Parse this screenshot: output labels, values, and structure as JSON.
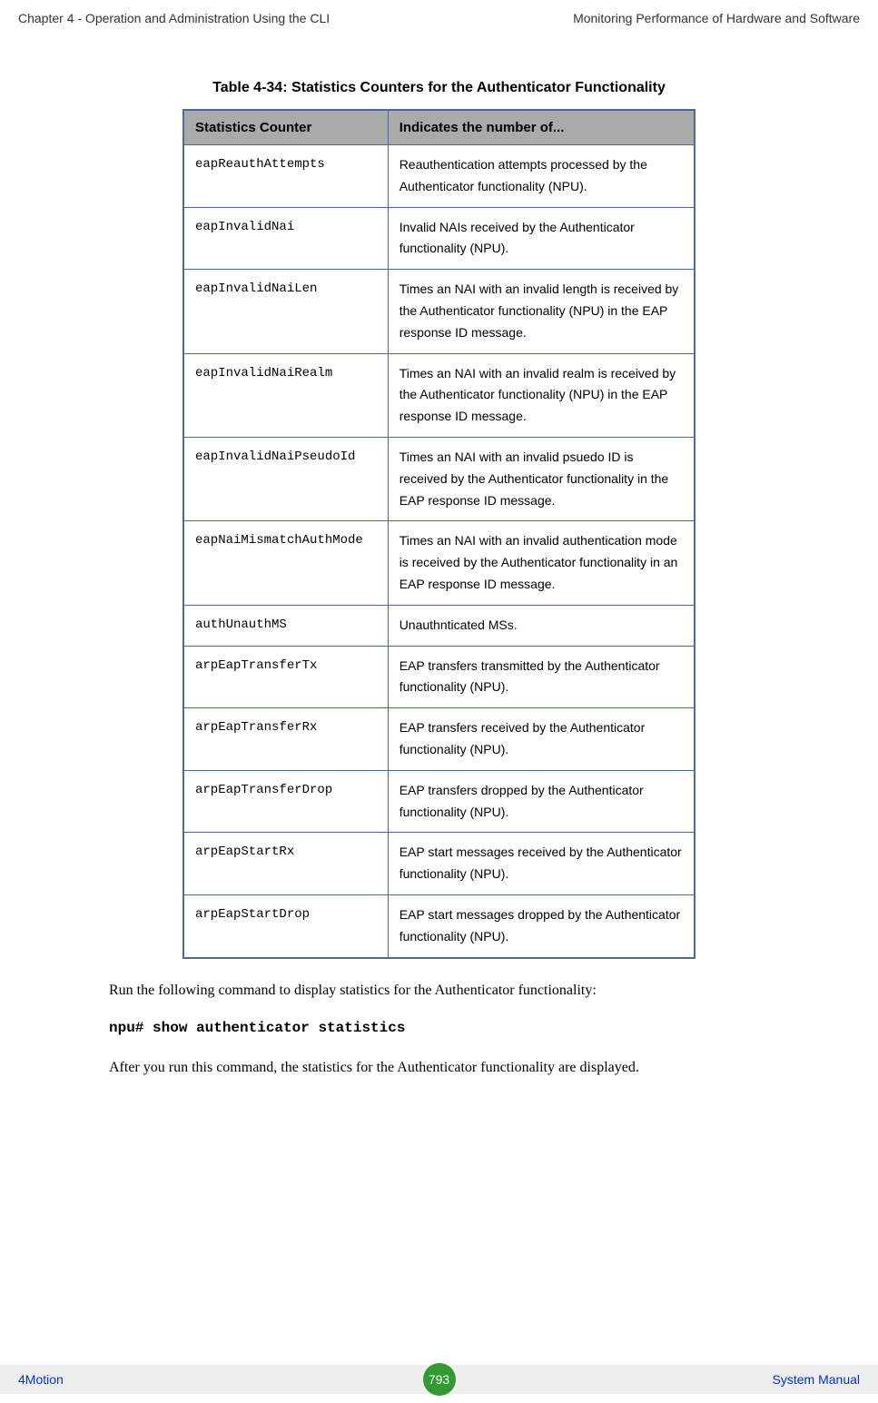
{
  "header": {
    "left": "Chapter 4 - Operation and Administration Using the CLI",
    "right": "Monitoring Performance of Hardware and Software"
  },
  "table": {
    "caption": "Table 4-34: Statistics Counters for the Authenticator Functionality",
    "headers": {
      "col1": "Statistics Counter",
      "col2": "Indicates the number of..."
    },
    "rows": [
      {
        "counter": "eapReauthAttempts",
        "desc": "Reauthentication attempts processed by the Authenticator functionality (NPU)."
      },
      {
        "counter": "eapInvalidNai",
        "desc": "Invalid NAIs received by the Authenticator functionality (NPU)."
      },
      {
        "counter": "eapInvalidNaiLen",
        "desc": "Times an NAI with an invalid length is received by the Authenticator functionality (NPU) in the EAP response ID message."
      },
      {
        "counter": "eapInvalidNaiRealm",
        "desc": "Times an NAI with an invalid realm is received by the Authenticator functionality (NPU) in the EAP response ID message."
      },
      {
        "counter": "eapInvalidNaiPseudoId",
        "desc": "Times an NAI with an invalid psuedo ID is received by the Authenticator functionality in the EAP response ID message."
      },
      {
        "counter": "eapNaiMismatchAuthMode",
        "desc": "Times an NAI with an invalid authentication mode is received by the Authenticator functionality in an EAP response ID message."
      },
      {
        "counter": "authUnauthMS",
        "desc": "Unauthnticated MSs."
      },
      {
        "counter": "arpEapTransferTx",
        "desc": "EAP transfers transmitted  by the Authenticator functionality (NPU)."
      },
      {
        "counter": "arpEapTransferRx",
        "desc": "EAP transfers received by the Authenticator functionality (NPU)."
      },
      {
        "counter": "arpEapTransferDrop",
        "desc": "EAP transfers dropped by the Authenticator functionality (NPU)."
      },
      {
        "counter": "arpEapStartRx",
        "desc": "EAP start messages received by the Authenticator functionality (NPU)."
      },
      {
        "counter": "arpEapStartDrop",
        "desc": "EAP start messages dropped by the Authenticator functionality (NPU)."
      }
    ]
  },
  "body": {
    "para1": "Run the following command to display statistics for the Authenticator functionality:",
    "command": "npu# show authenticator statistics",
    "para2": "After you run this command, the statistics for the Authenticator functionality are displayed."
  },
  "footer": {
    "left": "4Motion",
    "page": "793",
    "right": "System Manual"
  }
}
